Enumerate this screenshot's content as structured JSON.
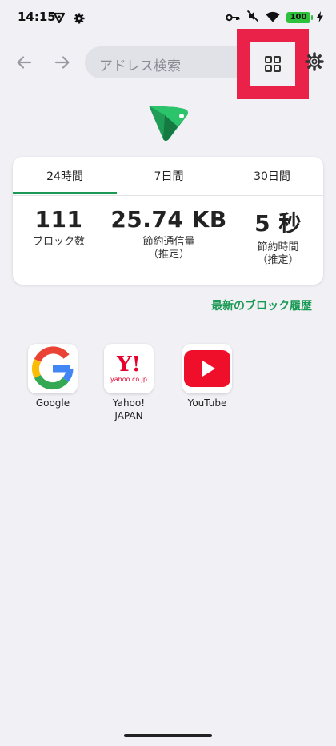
{
  "status_bar": {
    "time": "14:15",
    "battery": "100"
  },
  "toolbar": {
    "address_placeholder": "アドレス検索"
  },
  "stats": {
    "tabs": [
      {
        "label": "24時間"
      },
      {
        "label": "7日間"
      },
      {
        "label": "30日間"
      }
    ],
    "selected_tab": "24時間",
    "items": [
      {
        "value": "111",
        "label": "ブロック数",
        "note": ""
      },
      {
        "value": "25.74 KB",
        "label": "節約通信量",
        "note": "（推定）"
      },
      {
        "value": "5 秒",
        "label": "節約時間",
        "note": "（推定）"
      }
    ]
  },
  "history_link": "最新のブロック履歴",
  "shortcuts": [
    {
      "label": "Google",
      "icon": "google-icon"
    },
    {
      "label": "Yahoo!\nJAPAN",
      "icon": "yahoo-japan-icon",
      "logo_text": "Y!",
      "logo_sub": "yahoo.co.jp"
    },
    {
      "label": "YouTube",
      "icon": "youtube-icon"
    }
  ],
  "colors": {
    "accent": "#1a9a55",
    "highlight": "#ea2148",
    "background": "#f0f0f5"
  }
}
